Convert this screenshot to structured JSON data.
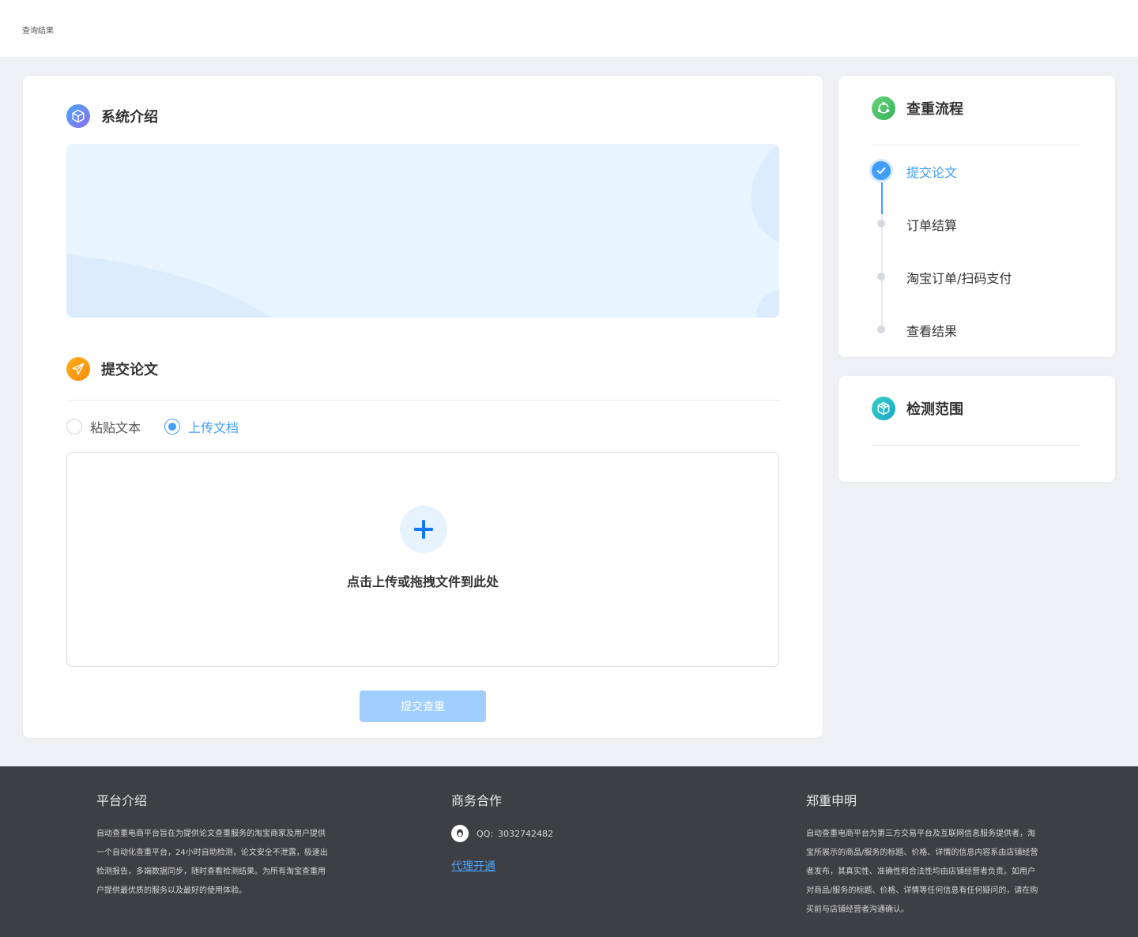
{
  "header": {
    "nav_label": "查询结果"
  },
  "intro": {
    "title": "系统介绍",
    "icon": "cube-icon"
  },
  "submit": {
    "title": "提交论文",
    "icon": "paper-plane-icon",
    "options": [
      {
        "label": "粘贴文本",
        "checked": false
      },
      {
        "label": "上传文档",
        "checked": true
      }
    ],
    "upload_text": "点击上传或拖拽文件到此处",
    "upload_icon": "plus-icon",
    "button_label": "提交查重"
  },
  "flow": {
    "title": "查重流程",
    "icon": "recycle-icon",
    "steps": [
      {
        "label": "提交论文",
        "status": "done"
      },
      {
        "label": "订单结算",
        "status": "pending"
      },
      {
        "label": "淘宝订单/扫码支付",
        "status": "pending"
      },
      {
        "label": "查看结果",
        "status": "pending"
      }
    ]
  },
  "range": {
    "title": "检测范围",
    "icon": "cube-outline-icon"
  },
  "footer": {
    "platform": {
      "title": "平台介绍",
      "lines": [
        "自动查重电商平台旨在为提供论文查重服务的淘宝商家及用户提供",
        "一个自动化查重平台，24小时自助检测，论文安全不泄露，极速出",
        "检测报告，多端数据同步，随时查看检测结果。为所有淘宝查重用",
        "户提供最优质的服务以及最好的使用体验。"
      ]
    },
    "business": {
      "title": "商务合作",
      "qq_label": "QQ:",
      "qq_number": "3032742482",
      "link_label": "代理开通"
    },
    "statement": {
      "title": "郑重申明",
      "lines": [
        "自动查重电商平台为第三方交易平台及互联网信息服务提供者，淘",
        "宝所展示的商品/服务的标题、价格、详情的信息内容系由店铺经营",
        "者发布，其真实性、准确性和合法性均由店铺经营者负责。如用户",
        "对商品/服务的标题、价格、详情等任何信息有任何疑问的，请在购",
        "买前与店铺经营者沟通确认。"
      ]
    }
  },
  "colors": {
    "primary": "#409eff",
    "button_disabled": "#a0cfff",
    "footer_bg": "#3e3f42",
    "page_bg": "#eff0f3"
  }
}
